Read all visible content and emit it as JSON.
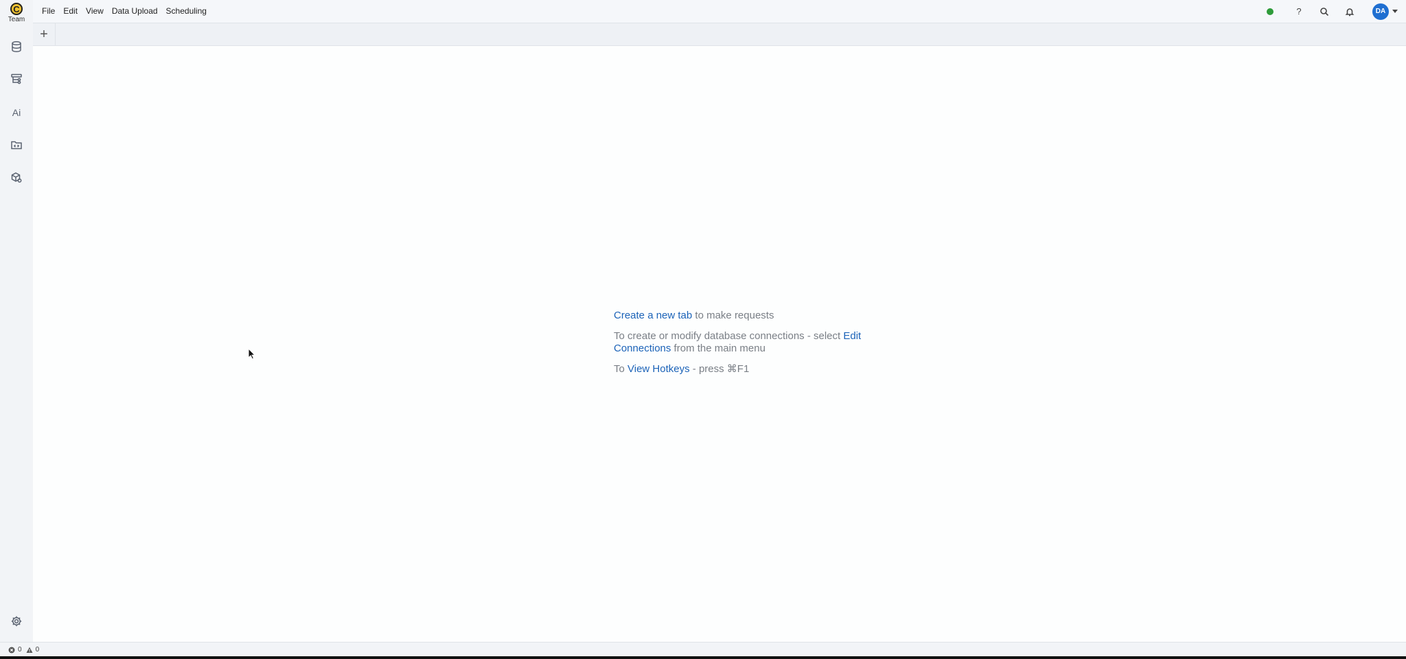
{
  "app": {
    "logo_letter": "C",
    "logo_label": "Team"
  },
  "menu": {
    "items": [
      "File",
      "Edit",
      "View",
      "Data Upload",
      "Scheduling"
    ]
  },
  "sidebar": {
    "items": [
      {
        "icon": "database-icon"
      },
      {
        "icon": "schema-tree-icon"
      },
      {
        "icon": "ai-icon",
        "label": "Ai"
      },
      {
        "icon": "script-folder-icon"
      },
      {
        "icon": "cube-settings-icon"
      }
    ],
    "bottom_icon": "gear-icon"
  },
  "header": {
    "status_color": "#2e9b3a",
    "help_label": "?",
    "avatar_initials": "DA",
    "avatar_color": "#1f6fd1"
  },
  "tabs": {
    "add_label": "+"
  },
  "welcome": {
    "line1_link": "Create a new tab",
    "line1_rest": " to make requests",
    "line2_prefix": "To create or modify database connections - select ",
    "line2_link": "Edit Connections",
    "line2_rest": " from the main menu",
    "line3_prefix": "To ",
    "line3_link": "View Hotkeys",
    "line3_rest": " - press ⌘F1"
  },
  "status_bar": {
    "errors": "0",
    "warnings": "0"
  },
  "colors": {
    "link": "#1c63b8",
    "muted_text": "#7a7f86"
  }
}
